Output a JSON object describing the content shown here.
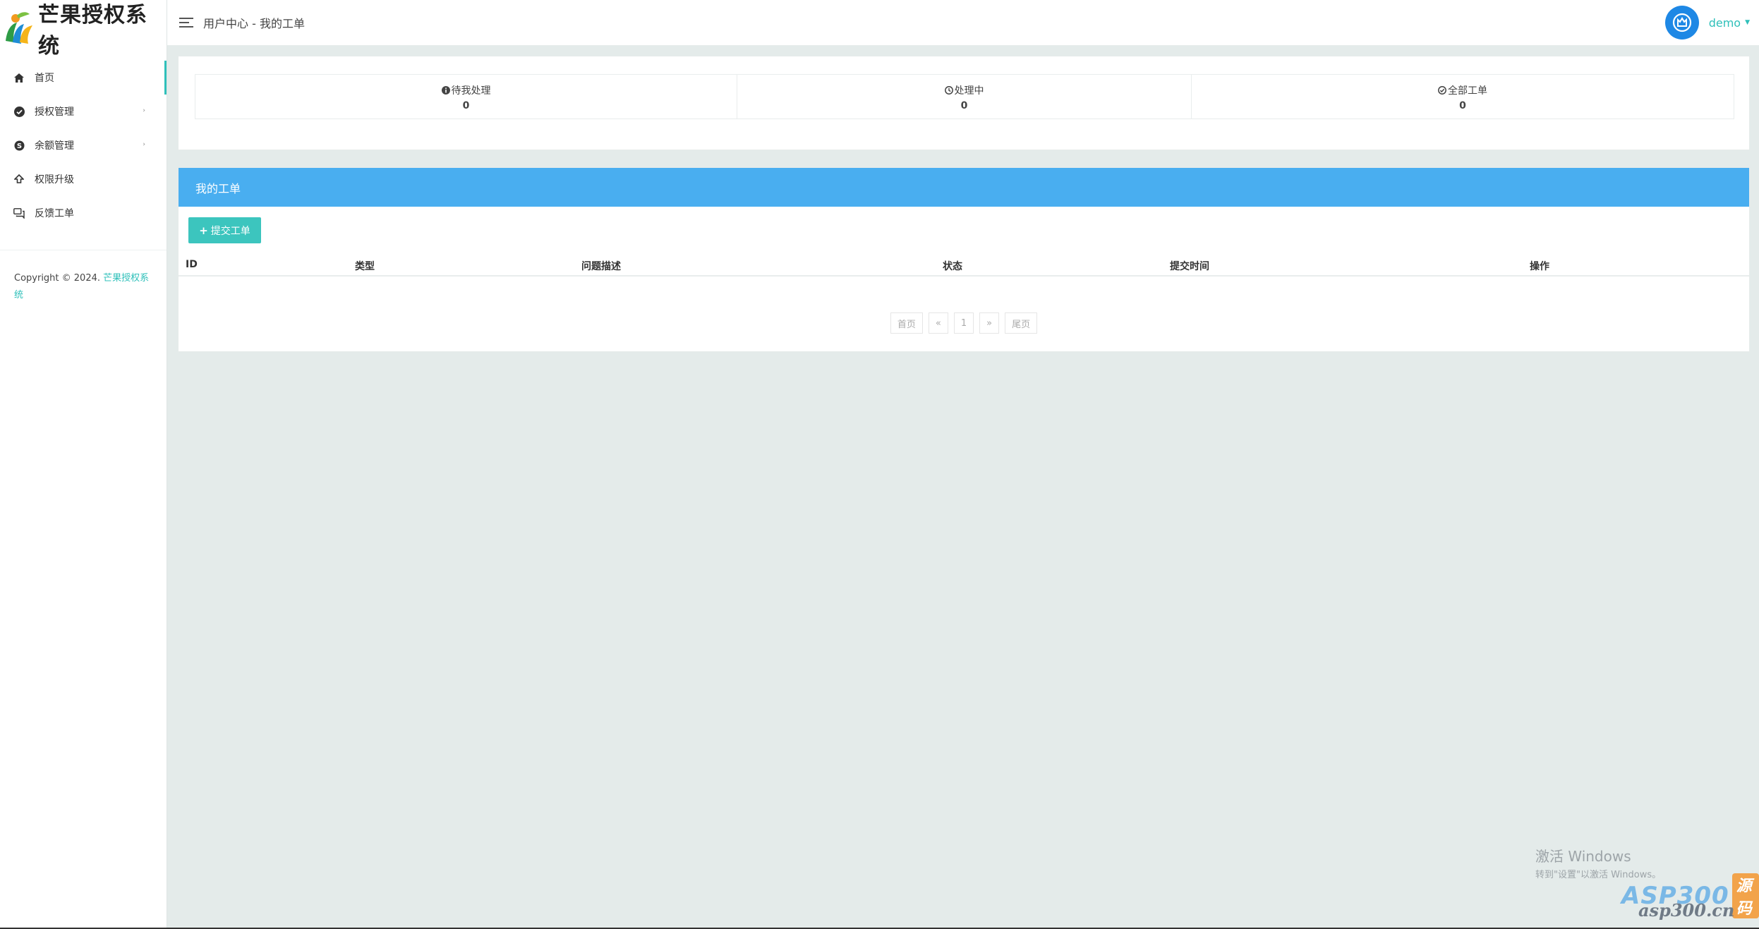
{
  "app": {
    "title": "芒果授权系统"
  },
  "sidebar": {
    "items": [
      {
        "label": "首页",
        "icon": "home-icon",
        "active": true,
        "has_submenu": false
      },
      {
        "label": "授权管理",
        "icon": "check-circle-icon",
        "active": false,
        "has_submenu": true
      },
      {
        "label": "余额管理",
        "icon": "skype-icon",
        "active": false,
        "has_submenu": true
      },
      {
        "label": "权限升级",
        "icon": "upgrade-arrow-icon",
        "active": false,
        "has_submenu": false
      },
      {
        "label": "反馈工单",
        "icon": "comments-icon",
        "active": false,
        "has_submenu": false
      }
    ],
    "copyright_prefix": "Copyright © 2024.",
    "copyright_link": "芒果授权系统"
  },
  "header": {
    "breadcrumb": "用户中心 - 我的工单",
    "username": "demo"
  },
  "stats": [
    {
      "label": "待我处理",
      "value": "0",
      "icon": "info-circle-icon"
    },
    {
      "label": "处理中",
      "value": "0",
      "icon": "clock-icon"
    },
    {
      "label": "全部工单",
      "value": "0",
      "icon": "check-circle-icon"
    }
  ],
  "tickets": {
    "title": "我的工单",
    "submit_label": "提交工单",
    "columns": [
      "ID",
      "类型",
      "问题描述",
      "状态",
      "提交时间",
      "操作"
    ],
    "rows": []
  },
  "pagination": {
    "first": "首页",
    "prev": "«",
    "current": "1",
    "next": "»",
    "last": "尾页"
  },
  "watermark": {
    "windows_line1": "激活 Windows",
    "windows_line2": "转到\"设置\"以激活 Windows。",
    "asp_brand": "ASP300",
    "asp_badge": "源码",
    "asp_url": "asp300.cn"
  },
  "colors": {
    "accent": "#2fc0ba",
    "panel_header": "#49aef0",
    "button": "#3cc5be",
    "avatar": "#1e88e5",
    "background": "#e4ebea"
  }
}
